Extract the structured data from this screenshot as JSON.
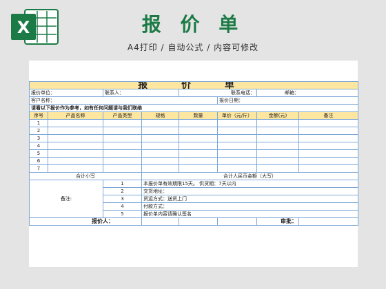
{
  "colors": {
    "accent": "#1b7a45",
    "header_fill": "#fde6a0",
    "grid": "#7aa6d6",
    "border_dark": "#1a50a0"
  },
  "logo": {
    "icon": "excel-icon",
    "letter": "X"
  },
  "hero": {
    "title": "报 价 单",
    "subtitle": "A4打印 / 自动公式 / 内容可修改"
  },
  "sheet": {
    "title": "报 价 单",
    "info": {
      "quoter_unit": "报价单位：",
      "contact": "联系人：",
      "phone": "联系电话：",
      "email": "邮箱：",
      "customer": "客户名称：",
      "quote_date": "报价日期："
    },
    "note_line": "请看以下报价作为参考，如有任何问题请与我们联络",
    "columns": [
      "序号",
      "产品名称",
      "产品类型",
      "规格",
      "数量",
      "单价（元/斤）",
      "金额(元)",
      "备注"
    ],
    "rows": [
      [
        "1",
        "",
        "",
        "",
        "",
        "",
        "",
        ""
      ],
      [
        "2",
        "",
        "",
        "",
        "",
        "",
        "",
        ""
      ],
      [
        "3",
        "",
        "",
        "",
        "",
        "",
        "",
        ""
      ],
      [
        "4",
        "",
        "",
        "",
        "",
        "",
        "",
        ""
      ],
      [
        "5",
        "",
        "",
        "",
        "",
        "",
        "",
        ""
      ],
      [
        "6",
        "",
        "",
        "",
        "",
        "",
        "",
        ""
      ],
      [
        "7",
        "",
        "",
        "",
        "",
        "",
        "",
        ""
      ]
    ],
    "subtotal_label": "合计小写",
    "total_label": "合计人民币金额（大写）",
    "remarks_label": "备注:",
    "remarks": [
      {
        "no": "1",
        "text": "本报价单有效期限15天。    供货期：7天以内"
      },
      {
        "no": "2",
        "text": "交货地址："
      },
      {
        "no": "3",
        "text": "货运方式：送货上门"
      },
      {
        "no": "4",
        "text": "付款方式："
      },
      {
        "no": "5",
        "text": "报价单内容请确认签名"
      }
    ],
    "signer_label": "报价人：",
    "approver_label": "审批："
  }
}
